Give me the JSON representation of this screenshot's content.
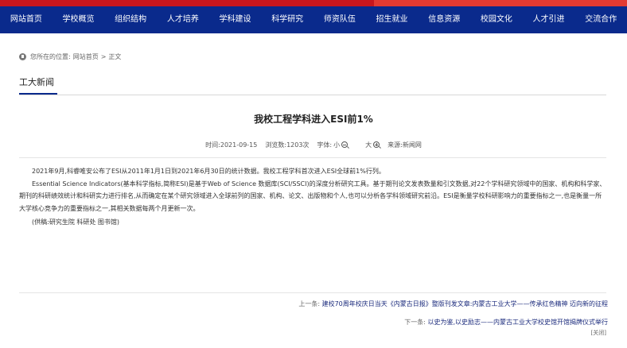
{
  "nav": {
    "items": [
      "网站首页",
      "学校概览",
      "组织结构",
      "人才培养",
      "学科建设",
      "科学研究",
      "师资队伍",
      "招生就业",
      "信息资源",
      "校园文化",
      "人才引进",
      "交流合作"
    ]
  },
  "colors": {
    "nav_bg": "#0a2a8c",
    "accent_red": "#d9262c"
  },
  "breadcrumb": {
    "prefix": "您所在的位置:",
    "home": "网站首页",
    "sep": ">",
    "current": "正文"
  },
  "section": {
    "title": "工大新闻"
  },
  "article": {
    "title": "我校工程学科进入ESI前1%",
    "meta": {
      "time_label": "时间:",
      "time": "2021-09-15",
      "views_label": "浏览数:",
      "views": "1203次",
      "font_label": "字体:",
      "small": "小",
      "large": "大",
      "source_label": "来源:",
      "source": "新闻网"
    },
    "paragraphs": [
      "2021年9月,科睿唯安公布了ESI从2011年1月1日到2021年6月30日的统计数据。我校工程学科首次进入ESI全球前1%行列。",
      "Essential Science Indicators(基本科学指标,简称ESI)是基于Web of Science 数据库(SCI/SSCI)的深度分析研究工具。基于期刊论文发表数量和引文数据,对22个学科研究领域中的国家、机构和科学家、期刊的科研绩效统计和科研实力进行排名,从而确定在某个研究领域进入全球前列的国家、机构、论文、出版物和个人,也可以分析各学科领域研究前沿。ESI是衡量学校科研影响力的重要指标之一,也是衡量一所大学核心竞争力的重要指标之一,其相关数据每两个月更新一次。"
    ],
    "source_note": "(供稿:研究生院 科研处 图书馆)"
  },
  "pager": {
    "prev_label": "上一条:",
    "prev_title": "建校70周年校庆日当天《内蒙古日报》整版刊发文章:内蒙古工业大学——传承红色精神 迈向新的征程",
    "next_label": "下一条:",
    "next_title": "以史为鉴,以史励志——内蒙古工业大学校史馆开馆揭牌仪式举行",
    "close": "[关闭]"
  }
}
